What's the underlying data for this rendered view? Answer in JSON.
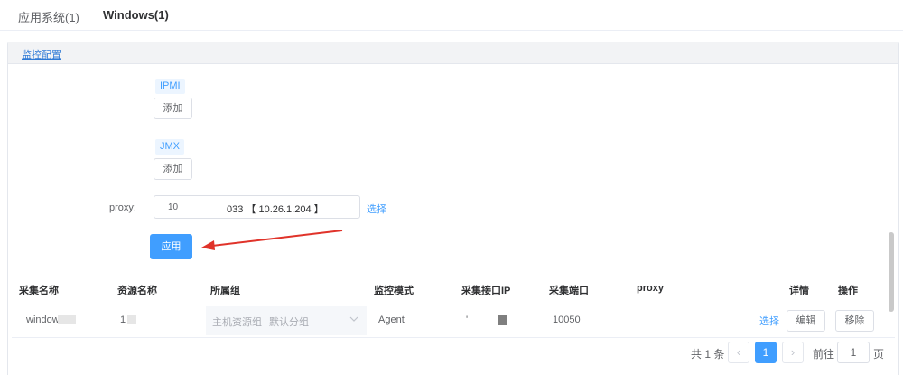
{
  "top_tabs": [
    "应用系统(1)",
    "Windows(1)"
  ],
  "panel": {
    "title": "监控配置"
  },
  "protocols": [
    {
      "tag": "IPMI",
      "add_label": "添加"
    },
    {
      "tag": "JMX",
      "add_label": "添加"
    }
  ],
  "proxy": {
    "label": "proxy:",
    "value_prefix": "10",
    "value_suffix": "033 【 10.26.1.204 】",
    "select_label": "选择"
  },
  "apply_label": "应用",
  "table": {
    "headers": [
      "采集名称",
      "资源名称",
      "所属组",
      "监控模式",
      "采集接口IP",
      "采集端口",
      "proxy",
      "详情",
      "操作"
    ],
    "row": {
      "collect_name": "window",
      "resource_name": "1",
      "group_a": "主机资源组",
      "group_b": "默认分组",
      "mode": "Agent",
      "ip": "'",
      "port": "10050",
      "detail_link": "选择",
      "edit_label": "编辑",
      "remove_label": "移除"
    }
  },
  "pagination": {
    "total": "共 1 条",
    "prev_icon": "‹",
    "current": "1",
    "next_icon": "›",
    "goto_label": "前往",
    "goto_value": "1",
    "page_label": "页"
  },
  "colors": {
    "primary": "#409eff",
    "arrow": "#e0332a"
  }
}
